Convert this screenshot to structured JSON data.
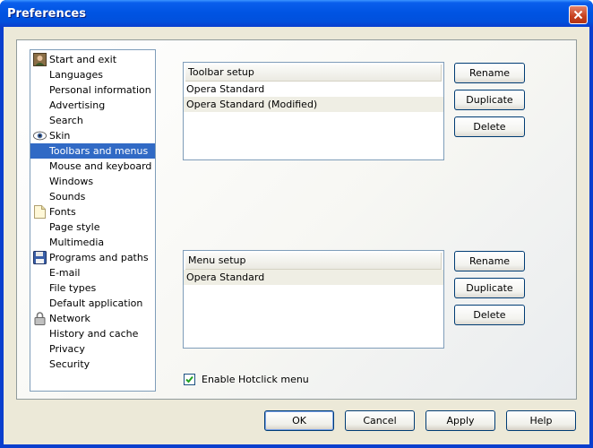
{
  "window": {
    "title": "Preferences"
  },
  "sidebar": {
    "selected_index": 6,
    "items": [
      {
        "label": "Start and exit",
        "icon": "person-icon"
      },
      {
        "label": "Languages",
        "icon": ""
      },
      {
        "label": "Personal information",
        "icon": ""
      },
      {
        "label": "Advertising",
        "icon": ""
      },
      {
        "label": "Search",
        "icon": ""
      },
      {
        "label": "Skin",
        "icon": "eye-icon"
      },
      {
        "label": "Toolbars and menus",
        "icon": ""
      },
      {
        "label": "Mouse and keyboard",
        "icon": ""
      },
      {
        "label": "Windows",
        "icon": ""
      },
      {
        "label": "Sounds",
        "icon": ""
      },
      {
        "label": "Fonts",
        "icon": "page-icon"
      },
      {
        "label": "Page style",
        "icon": ""
      },
      {
        "label": "Multimedia",
        "icon": ""
      },
      {
        "label": "Programs and paths",
        "icon": "floppy-icon"
      },
      {
        "label": "E-mail",
        "icon": ""
      },
      {
        "label": "File types",
        "icon": ""
      },
      {
        "label": "Default application",
        "icon": ""
      },
      {
        "label": "Network",
        "icon": "lock-icon"
      },
      {
        "label": "History and cache",
        "icon": ""
      },
      {
        "label": "Privacy",
        "icon": ""
      },
      {
        "label": "Security",
        "icon": ""
      }
    ]
  },
  "toolbar_setup": {
    "header": "Toolbar setup",
    "rows": [
      "Opera Standard",
      "Opera Standard (Modified)"
    ],
    "buttons": {
      "rename": "Rename",
      "duplicate": "Duplicate",
      "delete": "Delete"
    }
  },
  "menu_setup": {
    "header": "Menu setup",
    "rows": [
      "Opera Standard"
    ],
    "buttons": {
      "rename": "Rename",
      "duplicate": "Duplicate",
      "delete": "Delete"
    }
  },
  "hotclick": {
    "label": "Enable Hotclick menu",
    "checked": true
  },
  "dialog_buttons": {
    "ok": "OK",
    "cancel": "Cancel",
    "apply": "Apply",
    "help": "Help"
  },
  "colors": {
    "selection": "#316ac5",
    "titlebar": "#0054e3",
    "face": "#ece9d8"
  }
}
